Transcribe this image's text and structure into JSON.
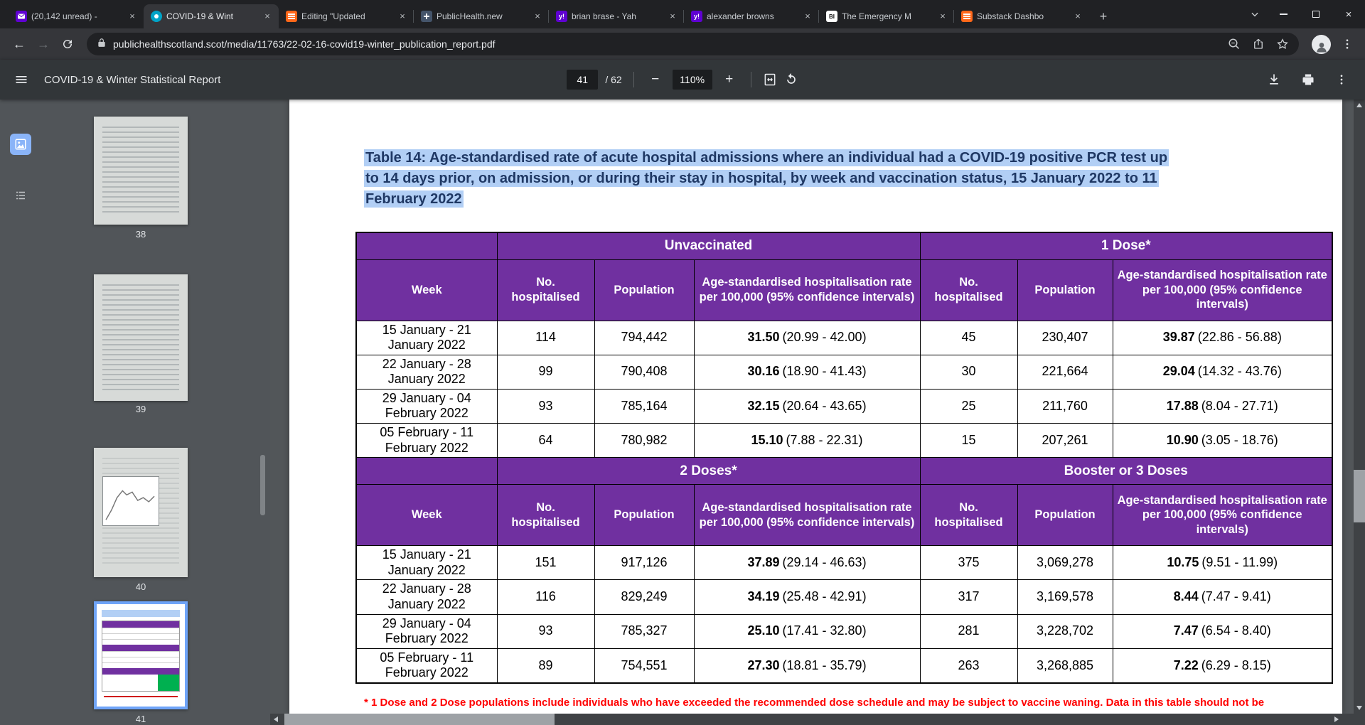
{
  "icons": {
    "close": "×",
    "plus": "+",
    "minus": "−",
    "back": "←",
    "forward": "→",
    "yahoo_glyph": "y!",
    "bi_glyph": "BI"
  },
  "browser": {
    "tabs": [
      {
        "label": "(20,142 unread) -"
      },
      {
        "label": "COVID-19 & Wint"
      },
      {
        "label": "Editing \"Updated"
      },
      {
        "label": "PublicHealth.new"
      },
      {
        "label": "brian brase - Yah"
      },
      {
        "label": "alexander browns"
      },
      {
        "label": "The Emergency M"
      },
      {
        "label": "Substack Dashbo"
      }
    ],
    "address": {
      "url": "publichealthscotland.scot/media/11763/22-02-16-covid19-winter_publication_report.pdf"
    }
  },
  "pdf": {
    "toolbar": {
      "title": "COVID-19 & Winter Statistical Report",
      "page": "41",
      "page_total": "/ 62",
      "zoom": "110%"
    },
    "thumbnails": [
      {
        "page": "38"
      },
      {
        "page": "39"
      },
      {
        "page": "40"
      },
      {
        "page": "41"
      }
    ]
  },
  "doc": {
    "heading_lines": [
      "Table 14: Age-standardised rate of acute hospital admissions where an individual had a COVID-19 positive PCR test up",
      "to 14 days prior, on admission, or during their stay in hospital, by week and vaccination status, 15 January 2022 to 11",
      "February 2022"
    ],
    "footnote": "* 1 Dose and 2 Dose populations include individuals who have exceeded the recommended dose schedule and may be subject to vaccine waning. Data in this table should not be",
    "table": {
      "sections": [
        {
          "group_left": "Unvaccinated",
          "group_right": "1 Dose*",
          "h_week": "Week",
          "h_hosp": "No.\nhospitalised",
          "h_pop": "Population",
          "h_rate": "Age-standardised hospitalisation rate per 100,000 (95% confidence intervals)",
          "rows": [
            {
              "week": "15 January - 21 January 2022",
              "a_hosp": "114",
              "a_pop": "794,442",
              "a_rate": "31.50",
              "a_ci": "(20.99 - 42.00)",
              "b_hosp": "45",
              "b_pop": "230,407",
              "b_rate": "39.87",
              "b_ci": "(22.86 - 56.88)"
            },
            {
              "week": "22 January - 28 January 2022",
              "a_hosp": "99",
              "a_pop": "790,408",
              "a_rate": "30.16",
              "a_ci": "(18.90 - 41.43)",
              "b_hosp": "30",
              "b_pop": "221,664",
              "b_rate": "29.04",
              "b_ci": "(14.32 - 43.76)"
            },
            {
              "week": "29 January - 04 February 2022",
              "a_hosp": "93",
              "a_pop": "785,164",
              "a_rate": "32.15",
              "a_ci": "(20.64 - 43.65)",
              "b_hosp": "25",
              "b_pop": "211,760",
              "b_rate": "17.88",
              "b_ci": "(8.04 - 27.71)"
            },
            {
              "week": "05 February - 11 February 2022",
              "a_hosp": "64",
              "a_pop": "780,982",
              "a_rate": "15.10",
              "a_ci": "(7.88 - 22.31)",
              "b_hosp": "15",
              "b_pop": "207,261",
              "b_rate": "10.90",
              "b_ci": "(3.05 - 18.76)"
            }
          ]
        },
        {
          "group_left": "2 Doses*",
          "group_right": "Booster or 3 Doses",
          "h_week": "Week",
          "h_hosp": "No.\nhospitalised",
          "h_pop": "Population",
          "h_rate": "Age-standardised hospitalisation rate per 100,000 (95% confidence intervals)",
          "rows": [
            {
              "week": "15 January - 21 January 2022",
              "a_hosp": "151",
              "a_pop": "917,126",
              "a_rate": "37.89",
              "a_ci": "(29.14 - 46.63)",
              "b_hosp": "375",
              "b_pop": "3,069,278",
              "b_rate": "10.75",
              "b_ci": "(9.51 - 11.99)"
            },
            {
              "week": "22 January - 28 January 2022",
              "a_hosp": "116",
              "a_pop": "829,249",
              "a_rate": "34.19",
              "a_ci": "(25.48 - 42.91)",
              "b_hosp": "317",
              "b_pop": "3,169,578",
              "b_rate": "8.44",
              "b_ci": "(7.47 - 9.41)"
            },
            {
              "week": "29 January - 04 February 2022",
              "a_hosp": "93",
              "a_pop": "785,327",
              "a_rate": "25.10",
              "a_ci": "(17.41 - 32.80)",
              "b_hosp": "281",
              "b_pop": "3,228,702",
              "b_rate": "7.47",
              "b_ci": "(6.54 - 8.40)"
            },
            {
              "week": "05 February - 11 February 2022",
              "a_hosp": "89",
              "a_pop": "754,551",
              "a_rate": "27.30",
              "a_ci": "(18.81 - 35.79)",
              "b_hosp": "263",
              "b_pop": "3,268,885",
              "b_rate": "7.22",
              "b_ci": "(6.29 - 8.15)"
            }
          ]
        }
      ]
    }
  }
}
